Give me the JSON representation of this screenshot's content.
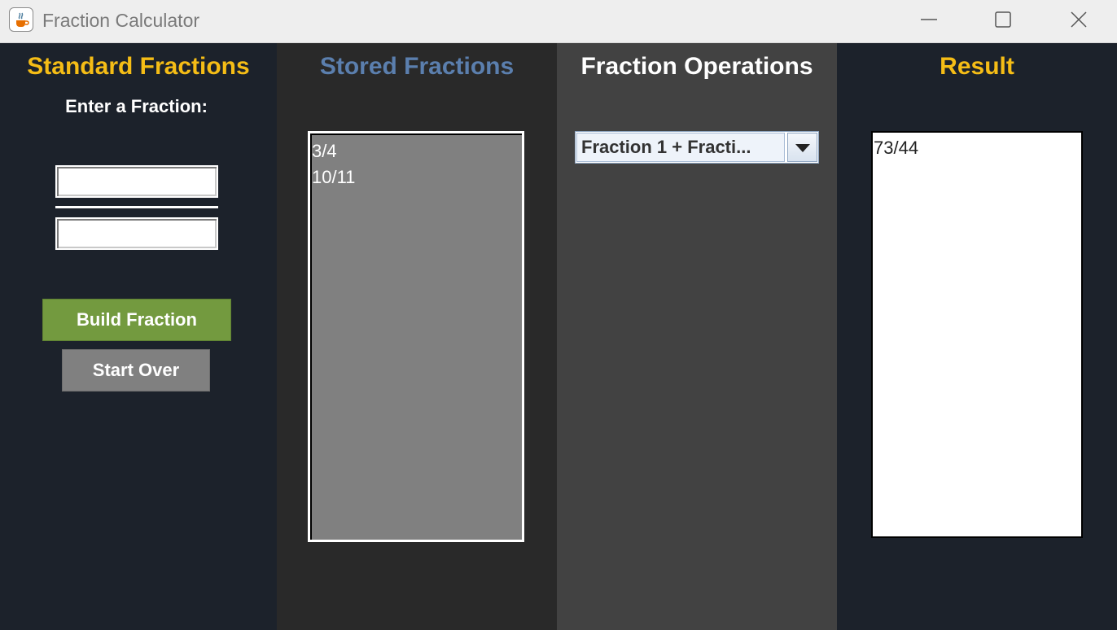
{
  "window": {
    "title": "Fraction Calculator",
    "icon": "java-cup-icon",
    "controls": [
      "minimize-icon",
      "maximize-icon",
      "close-icon"
    ]
  },
  "colors": {
    "accent_yellow": "#f5bd16",
    "stored_title_blue": "#5b7fae",
    "build_button_green": "#739a3f",
    "start_over_gray": "#808080",
    "panel_dark_navy": "#1c222b",
    "panel_dark_gray": "#292929",
    "panel_mid_gray": "#424242"
  },
  "standard": {
    "title": "Standard Fractions",
    "subtitle": "Enter a Fraction:",
    "numerator_value": "",
    "denominator_value": "",
    "build_label": "Build Fraction",
    "start_over_label": "Start Over"
  },
  "stored": {
    "title": "Stored Fractions",
    "items": [
      "3/4",
      "10/11"
    ]
  },
  "operations": {
    "title": "Fraction Operations",
    "selected": "Fraction 1 + Fracti..."
  },
  "result": {
    "title": "Result",
    "value": "73/44"
  }
}
